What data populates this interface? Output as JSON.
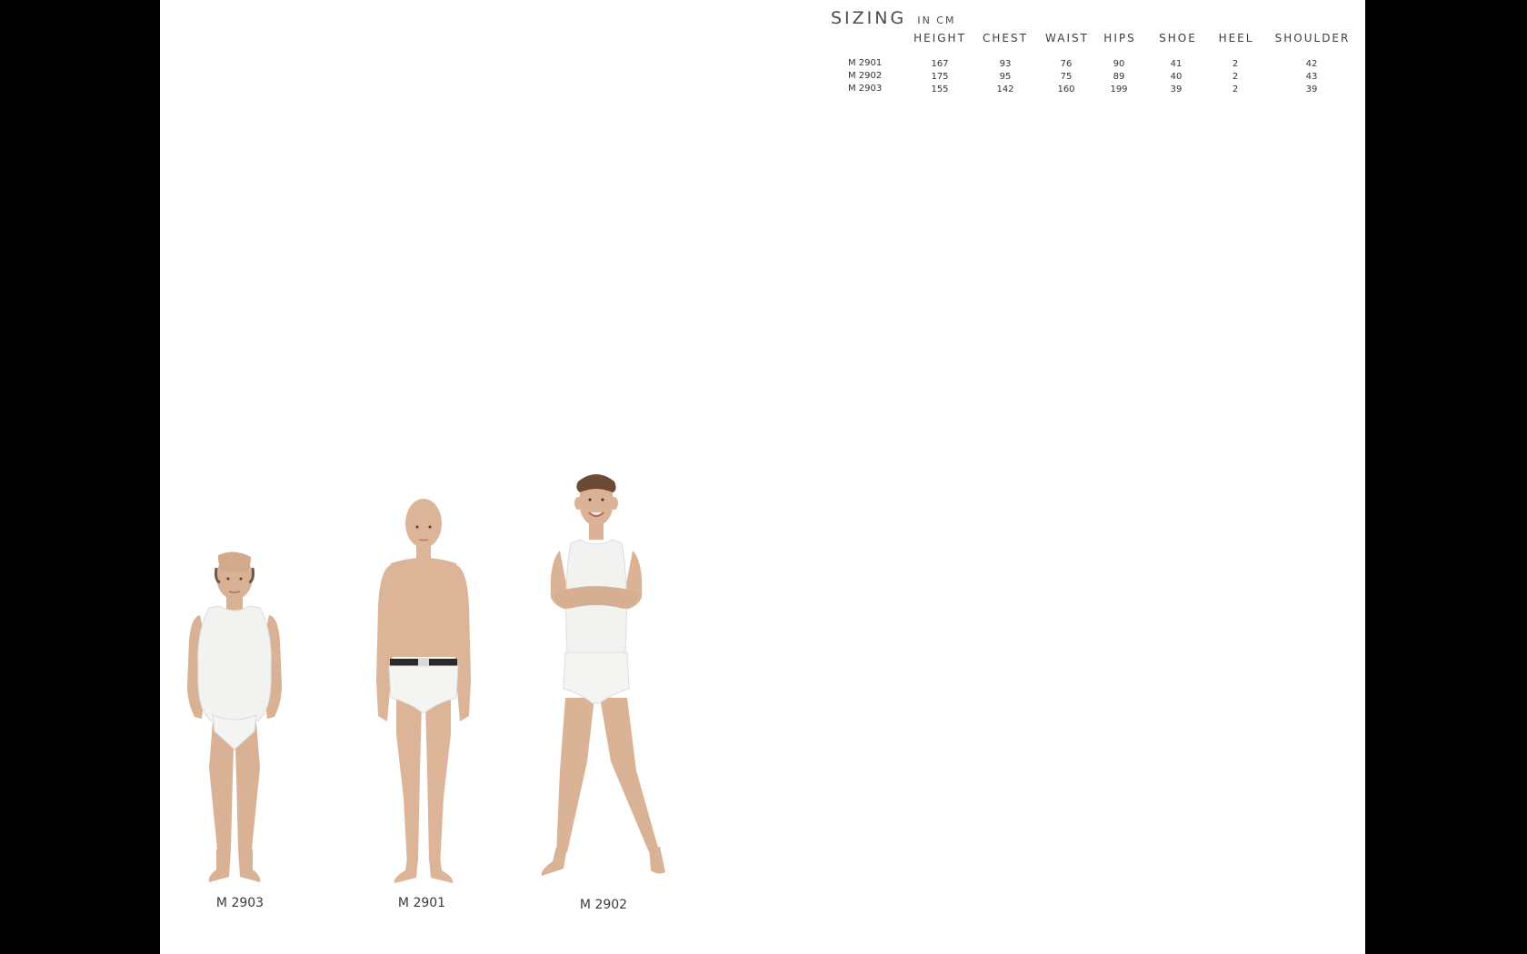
{
  "sizing": {
    "title": "SIZING",
    "unit": "IN CM",
    "columns": [
      "HEIGHT",
      "CHEST",
      "WAIST",
      "HIPS",
      "SHOE",
      "HEEL",
      "SHOULDER"
    ],
    "rows": [
      {
        "model": "M 2901",
        "values": [
          "167",
          "93",
          "76",
          "90",
          "41",
          "2",
          "42"
        ]
      },
      {
        "model": "M 2902",
        "values": [
          "175",
          "95",
          "75",
          "89",
          "40",
          "2",
          "43"
        ]
      },
      {
        "model": "M 2903",
        "values": [
          "155",
          "142",
          "160",
          "199",
          "39",
          "2",
          "39"
        ]
      }
    ]
  },
  "mannequins": [
    {
      "label": "M 2903"
    },
    {
      "label": "M 2901"
    },
    {
      "label": "M 2902"
    }
  ]
}
